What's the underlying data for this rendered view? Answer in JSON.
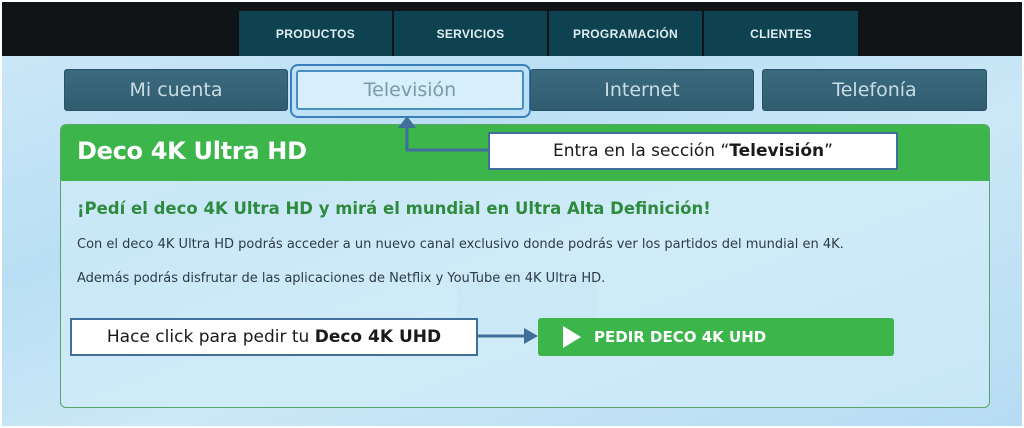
{
  "nav": {
    "items": [
      {
        "label": "PRODUCTOS"
      },
      {
        "label": "SERVICIOS"
      },
      {
        "label": "PROGRAMACIÓN"
      },
      {
        "label": "CLIENTES"
      }
    ]
  },
  "tabs": {
    "items": [
      {
        "label": "Mi cuenta",
        "active": false
      },
      {
        "label": "Televisión",
        "active": true
      },
      {
        "label": "Internet",
        "active": false
      },
      {
        "label": "Telefonía",
        "active": false
      }
    ]
  },
  "panel": {
    "title": "Deco 4K Ultra HD",
    "headline": "¡Pedí el deco 4K Ultra HD y mirá el mundial en Ultra Alta Definición!",
    "paragraph1": "Con el deco 4K Ultra HD podrás acceder a un nuevo canal exclusivo donde podrás ver los partidos del mundial en 4K.",
    "paragraph2": "Además podrás disfrutar de las aplicaciones de Netflix y YouTube en 4K Ultra HD.",
    "cta_label": "PEDIR DECO 4K UHD"
  },
  "callouts": {
    "tv": {
      "prefix": "Entra en la sección “",
      "bold": "Televisión",
      "suffix": "”"
    },
    "order": {
      "prefix": "Hace click para pedir tu ",
      "bold": "Deco 4K UHD"
    }
  },
  "colors": {
    "nav_bg": "#0f4250",
    "topbar_bg": "#111416",
    "tab_bg": "#315c6f",
    "accent_green": "#3cb54a",
    "callout_border": "#3f6f9a"
  },
  "icons": {
    "cta_icon": "play-icon"
  }
}
